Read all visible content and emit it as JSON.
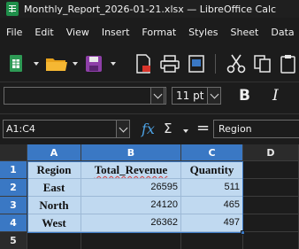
{
  "window": {
    "title": "Monthly_Report_2026-01-21.xlsx — LibreOffice Calc"
  },
  "menu": [
    "File",
    "Edit",
    "View",
    "Insert",
    "Format",
    "Styles",
    "Sheet",
    "Data"
  ],
  "format_bar": {
    "font_name": "",
    "font_size": "11 pt",
    "bold_label": "B",
    "italic_label": "I"
  },
  "formula_bar": {
    "name_box": "A1:C4",
    "fx_label": "fx",
    "sum_label": "Σ",
    "equals_label": "=",
    "content": "Region"
  },
  "sheet": {
    "column_headers": [
      "A",
      "B",
      "C",
      "D"
    ],
    "row_headers": [
      "1",
      "2",
      "3",
      "4",
      "5"
    ],
    "rows": [
      [
        "Region",
        "Total_Revenue",
        "Quantity"
      ],
      [
        "East",
        "26595",
        "511"
      ],
      [
        "North",
        "24120",
        "465"
      ],
      [
        "West",
        "26362",
        "497"
      ]
    ],
    "selection_color": "#3a78c4",
    "selected_fill": "#c0d9f0"
  }
}
